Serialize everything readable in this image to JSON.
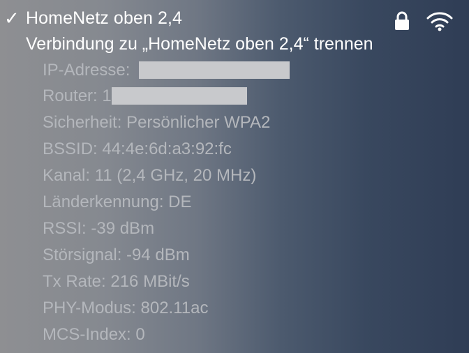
{
  "network": {
    "checkmark": "✓",
    "name": "HomeNetz oben 2,4",
    "lock_icon": "lock-icon",
    "wifi_icon": "wifi-icon"
  },
  "disconnect": {
    "label": "Verbindung zu „HomeNetz oben 2,4“ trennen"
  },
  "details": {
    "ip_label": "IP-Adresse:",
    "router_label": "Router: 1",
    "security": "Sicherheit: Persönlicher WPA2",
    "bssid": "BSSID: 44:4e:6d:a3:92:fc",
    "channel": "Kanal: 11 (2,4 GHz, 20 MHz)",
    "country_code": "Länderkennung: DE",
    "rssi": "RSSI: -39 dBm",
    "noise": "Störsignal: -94 dBm",
    "tx_rate": "Tx Rate: 216 MBit/s",
    "phy_mode": "PHY-Modus: 802.11ac",
    "mcs_index": "MCS-Index: 0"
  }
}
